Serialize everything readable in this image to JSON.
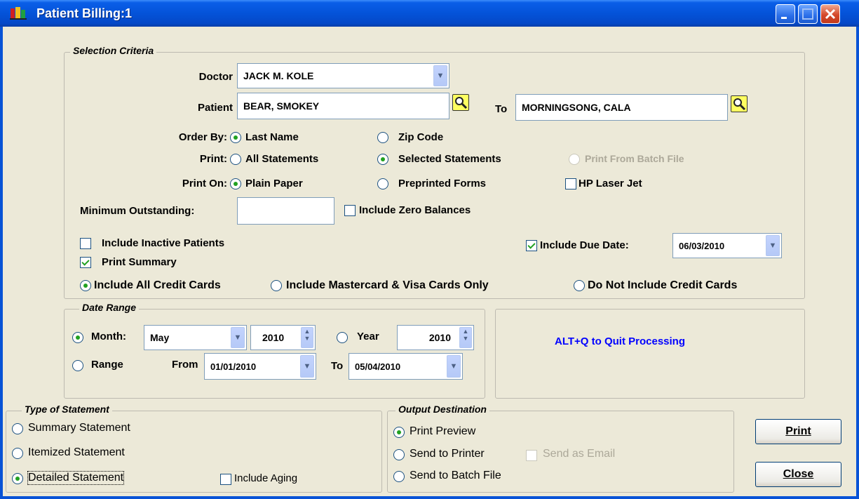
{
  "window": {
    "title": "Patient Billing:1"
  },
  "selection": {
    "legend": "Selection Criteria",
    "doctor_label": "Doctor",
    "doctor_value": "JACK M. KOLE",
    "patient_label": "Patient",
    "patient_from": "BEAR, SMOKEY",
    "to_label": "To",
    "patient_to": "MORNINGSONG, CALA",
    "order_by_label": "Order By:",
    "order_last_name": "Last Name",
    "order_zip": "Zip Code",
    "print_label": "Print:",
    "print_all": "All Statements",
    "print_selected": "Selected Statements",
    "print_batch": "Print From Batch File",
    "print_on_label": "Print On:",
    "plain_paper": "Plain Paper",
    "preprinted": "Preprinted Forms",
    "hp_laser": "HP Laser Jet",
    "min_outstanding_label": "Minimum Outstanding:",
    "min_outstanding_value": "",
    "include_zero": "Include Zero Balances",
    "include_inactive": "Include Inactive Patients",
    "print_summary": "Print Summary",
    "include_due_date": "Include Due Date:",
    "due_date_value": "06/03/2010",
    "cc_all": "Include All Credit Cards",
    "cc_mc_visa": "Include Mastercard & Visa Cards Only",
    "cc_none": "Do Not Include Credit Cards"
  },
  "date_range": {
    "legend": "Date Range",
    "month_label": "Month:",
    "month_value": "May",
    "month_year_value": "2010",
    "year_label": "Year",
    "year_value": "2010",
    "range_label": "Range",
    "from_label": "From",
    "from_value": "01/01/2010",
    "to_label": "To",
    "to_value": "05/04/2010"
  },
  "info": {
    "quit_hint": "ALT+Q to Quit Processing"
  },
  "statement_type": {
    "legend": "Type of Statement",
    "summary": "Summary Statement",
    "itemized": "Itemized Statement",
    "detailed": "Detailed Statement",
    "include_aging": "Include Aging"
  },
  "output": {
    "legend": "Output Destination",
    "preview": "Print Preview",
    "printer": "Send to Printer",
    "email": "Send as Email",
    "batch": "Send to Batch File"
  },
  "buttons": {
    "print": "Print",
    "close": "Close"
  }
}
